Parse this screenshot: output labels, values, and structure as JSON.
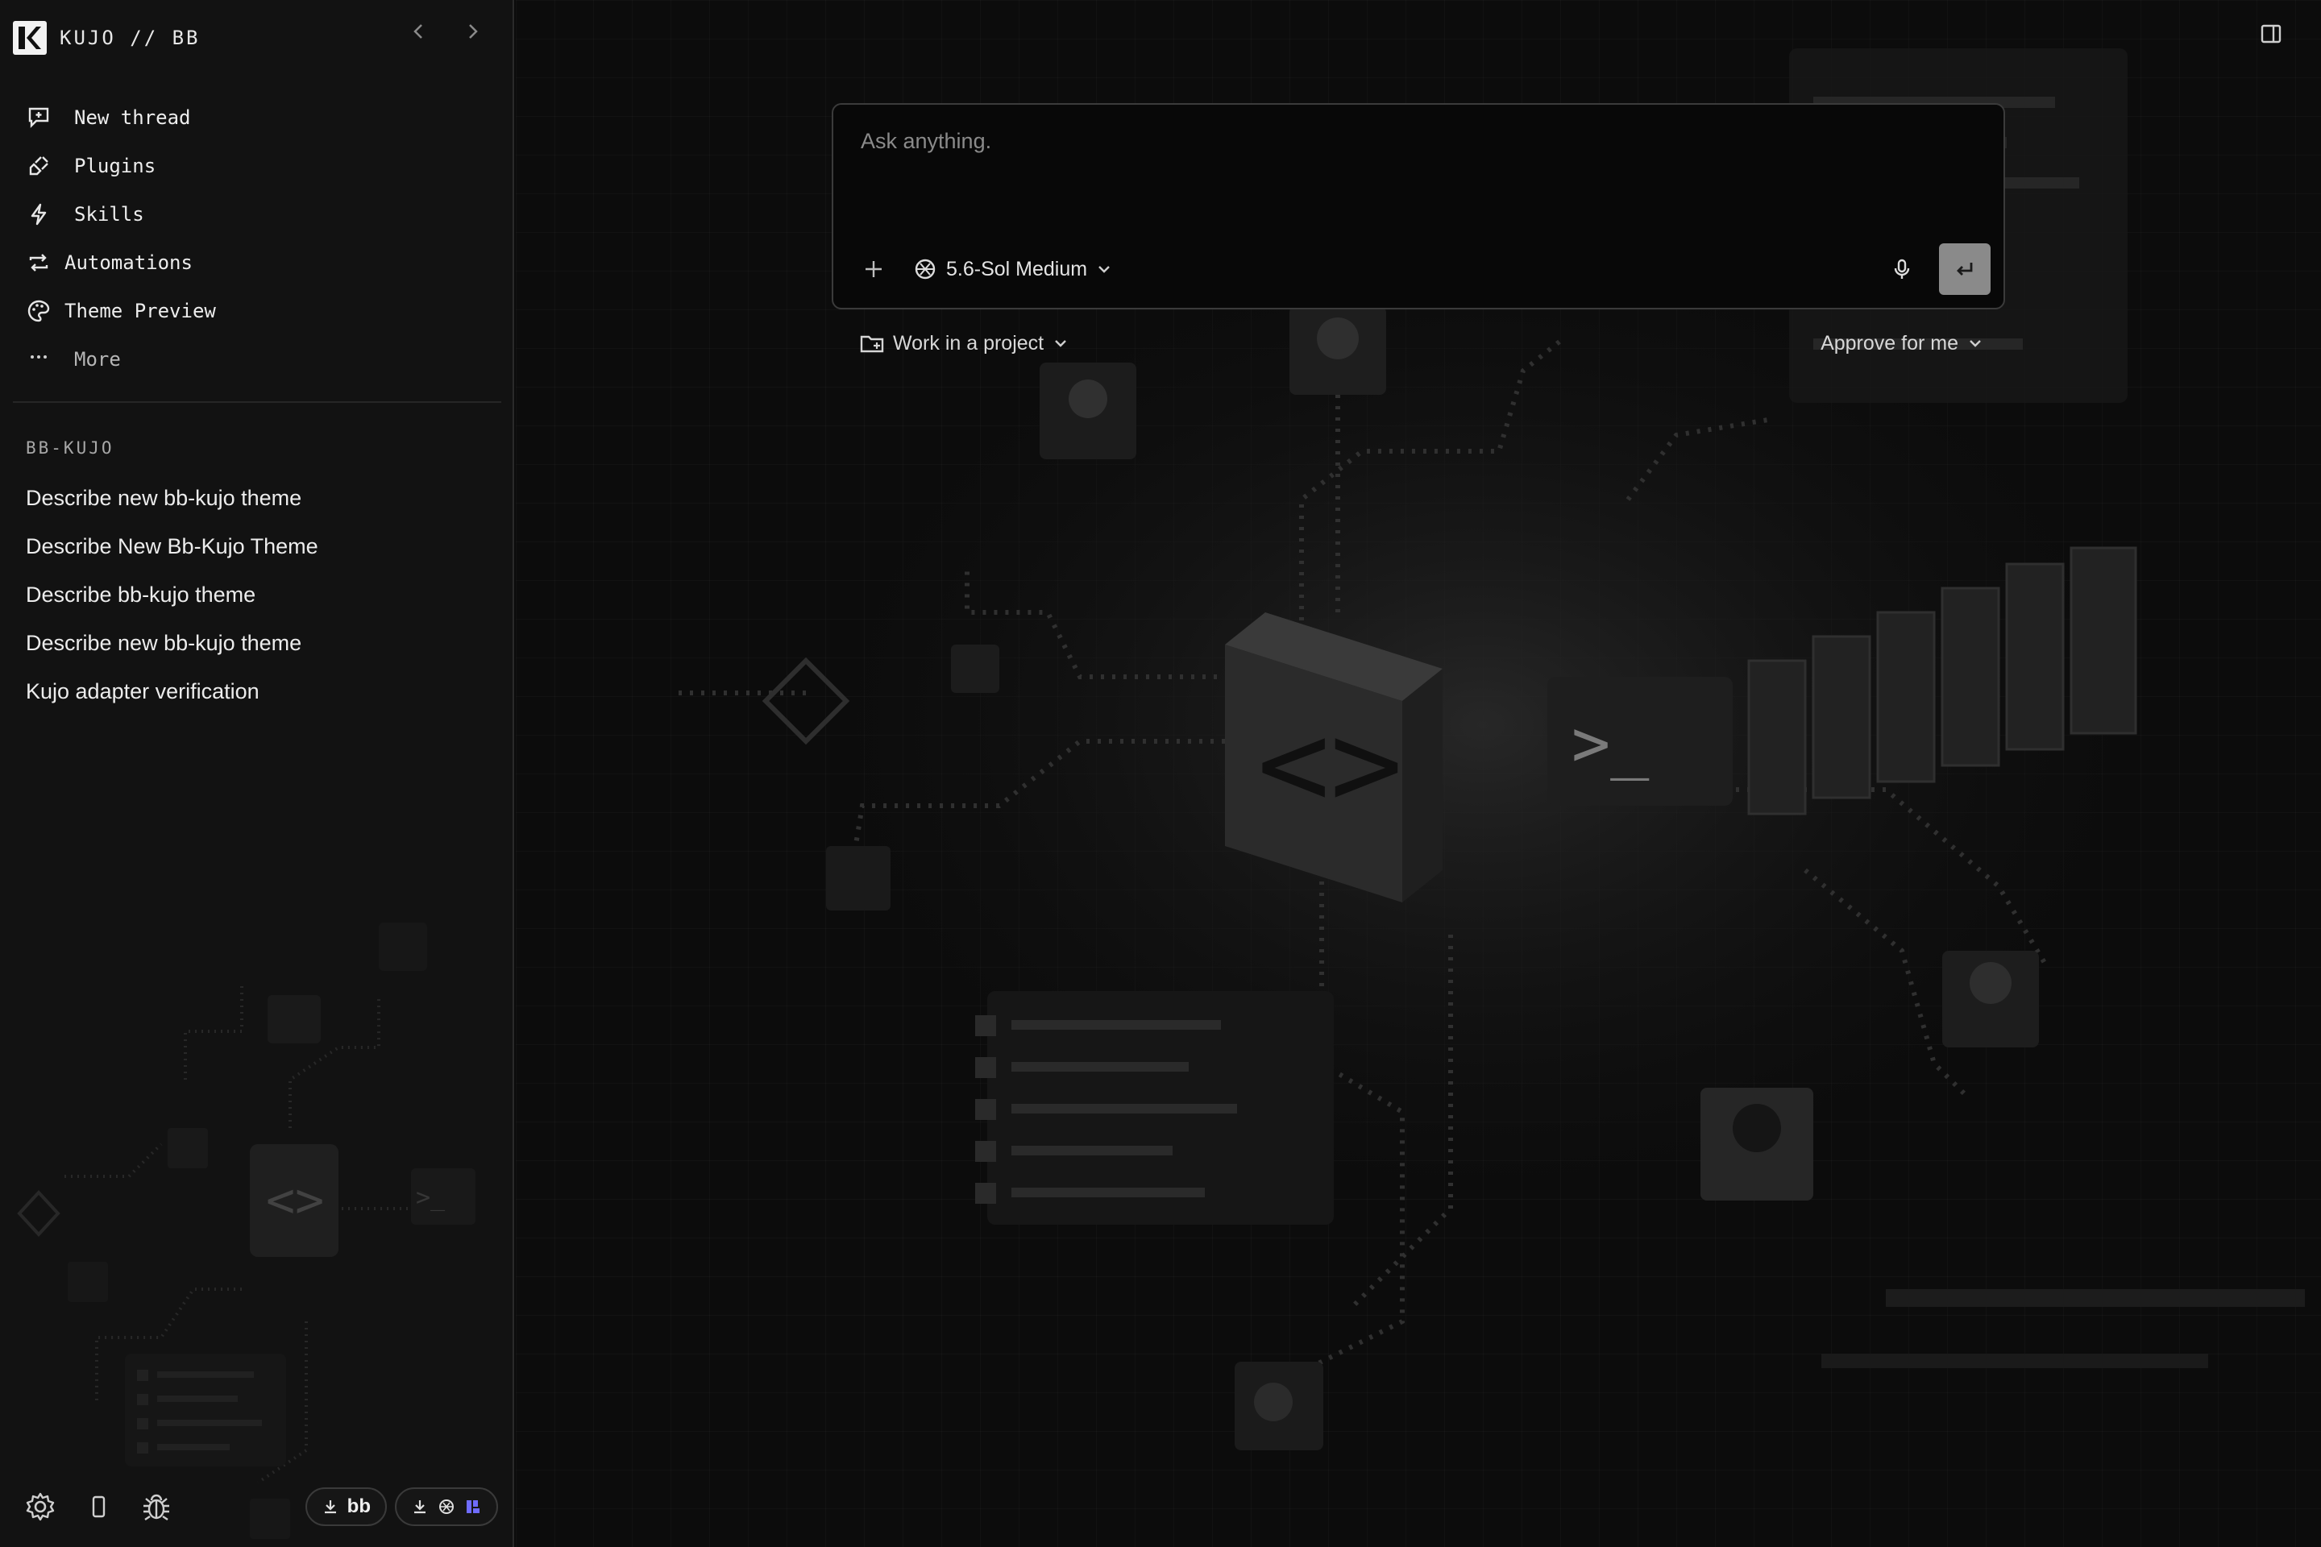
{
  "app": {
    "title": "KUJO // BB"
  },
  "sidebar": {
    "menu": [
      {
        "label": "New thread",
        "icon": "new-thread-icon"
      },
      {
        "label": "Plugins",
        "icon": "plug-icon"
      },
      {
        "label": "Skills",
        "icon": "lightning-icon"
      },
      {
        "label": "Automations",
        "icon": "repeat-icon"
      },
      {
        "label": "Theme Preview",
        "icon": "palette-icon"
      },
      {
        "label": "More",
        "icon": "ellipsis-icon"
      }
    ],
    "section_title": "BB-KUJO",
    "threads": [
      {
        "label": "Describe new bb-kujo theme"
      },
      {
        "label": "Describe New Bb-Kujo Theme"
      },
      {
        "label": "Describe bb-kujo theme"
      },
      {
        "label": "Describe new bb-kujo theme"
      },
      {
        "label": "Kujo adapter verification"
      }
    ],
    "footer": {
      "pill_bb_label": "bb"
    }
  },
  "composer": {
    "placeholder": "Ask anything.",
    "model_label": "5.6-Sol Medium"
  },
  "options": {
    "project_label": "Work in a project",
    "approval_label": "Approve for me"
  },
  "colors": {
    "background": "#0c0c0c",
    "sidebar": "#121212",
    "send_button": "#8a8a8a",
    "accent_badge": "#6f6cff"
  }
}
